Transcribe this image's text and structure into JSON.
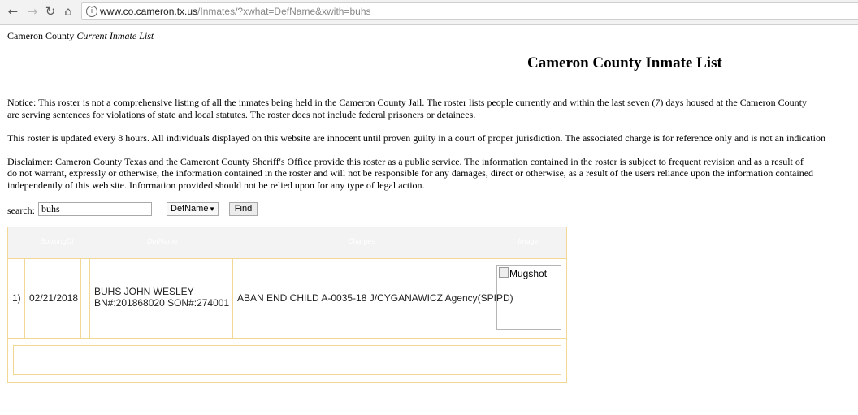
{
  "browser": {
    "back_icon": "arrow-left-icon",
    "forward_icon": "arrow-right-icon",
    "reload_icon": "reload-icon",
    "home_icon": "home-icon",
    "url_host": "www.co.cameron.tx.us",
    "url_path": "/Inmates/?xwhat=DefName&xwith=buhs"
  },
  "header": {
    "site_name": "Cameron County",
    "site_subtitle": "Current Inmate List",
    "page_title": "Cameron County Inmate List"
  },
  "notices": {
    "notice_line1": "Notice: This roster is not a comprehensive listing of all the inmates being held in the Cameron County Jail. The roster lists people currently and within the last seven (7) days housed at the Cameron County",
    "notice_line2": "are serving sentences for violations of state and local statutes. The roster does not include federal prisoners or detainees.",
    "update_line": "This roster is updated every 8 hours. All individuals displayed on this website are innocent until proven guilty in a court of proper jurisdiction. The associated charge is for reference only and is not an indication",
    "disclaimer_line1": "Disclaimer: Cameron County Texas and the Cameront County Sheriff's Office provide this roster as a public service. The information contained in the roster is subject to frequent revision and as a result of",
    "disclaimer_line2": "do not warrant, expressly or otherwise, the information contained in the roster and will not be responsible for any damages, direct or otherwise, as a result of the users reliance upon the information contained",
    "disclaimer_line3": "independently of this web site. Information provided should not be relied upon for any type of legal action."
  },
  "search": {
    "label": "search:",
    "value": "buhs",
    "field_selected": "DefName",
    "find_label": "Find"
  },
  "table": {
    "headers": [
      "BookingDt",
      "DefName",
      "Charges",
      "Image"
    ],
    "rows": [
      {
        "index": "1)",
        "booking_date": "02/21/2018",
        "name": "BUHS JOHN WESLEY",
        "numbers": "BN#:201868020 SON#:274001",
        "charges": "ABAN END CHILD A-0035-18 J/CYGANAWICZ Agency(SPIPD)",
        "image_alt": "Mugshot"
      }
    ]
  }
}
